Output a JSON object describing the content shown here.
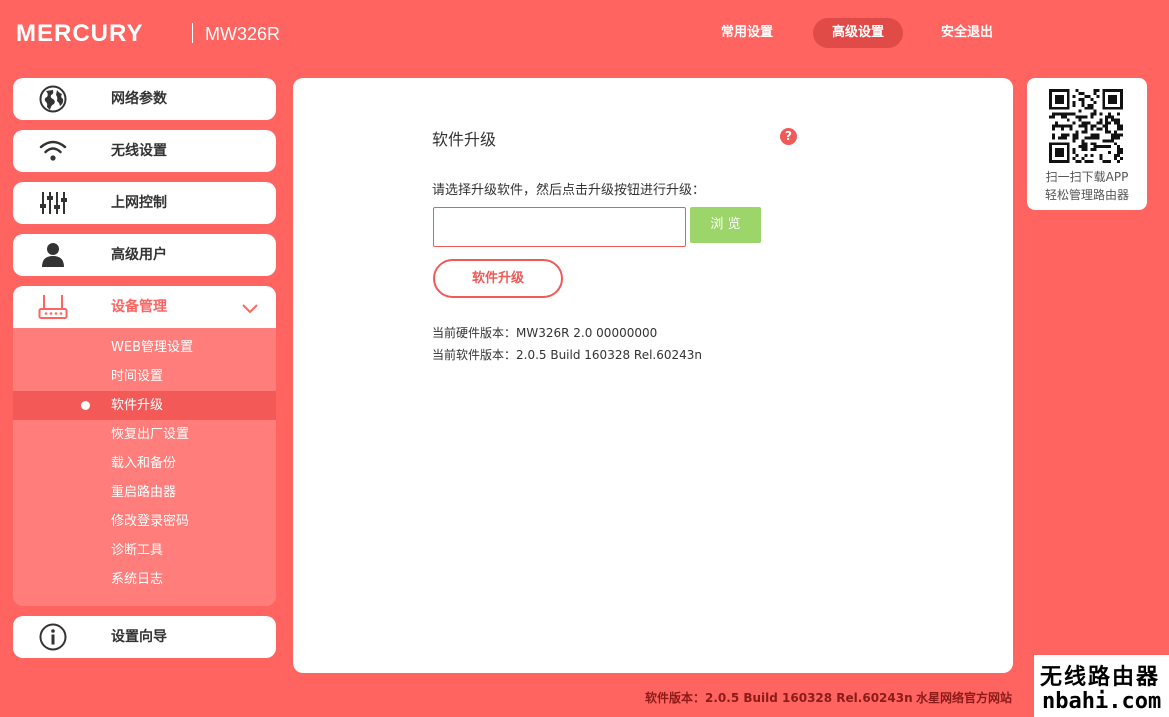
{
  "header": {
    "brand": "MERCURY",
    "model": "MW326R",
    "nav": {
      "common": "常用设置",
      "advanced": "高级设置",
      "logout": "安全退出"
    }
  },
  "sidebar": {
    "items": [
      {
        "label": "网络参数",
        "icon": "globe-icon"
      },
      {
        "label": "无线设置",
        "icon": "wifi-icon"
      },
      {
        "label": "上网控制",
        "icon": "sliders-icon"
      },
      {
        "label": "高级用户",
        "icon": "user-icon"
      },
      {
        "label": "设备管理",
        "icon": "router-icon"
      },
      {
        "label": "设置向导",
        "icon": "info-icon"
      }
    ],
    "submenu": [
      "WEB管理设置",
      "时间设置",
      "软件升级",
      "恢复出厂设置",
      "载入和备份",
      "重启路由器",
      "修改登录密码",
      "诊断工具",
      "系统日志"
    ]
  },
  "main": {
    "title": "软件升级",
    "help": "?",
    "instruction": "请选择升级软件，然后点击升级按钮进行升级：",
    "file_value": "",
    "browse_label": "浏 览",
    "upgrade_label": "软件升级",
    "hardware_version": "当前硬件版本：MW326R 2.0 00000000",
    "software_version": "当前软件版本：2.0.5 Build 160328 Rel.60243n"
  },
  "qr": {
    "line1": "扫一扫下载APP",
    "line2": "轻松管理路由器"
  },
  "footer": {
    "version": "软件版本：2.0.5 Build 160328 Rel.60243n",
    "link": "水星网络官方网站"
  },
  "watermark": {
    "line1": "无线路由器",
    "line2": "nbahi.com"
  },
  "colors": {
    "background": "#ff6461",
    "accent": "#f05a57",
    "browse": "#9cd56a",
    "footer_text": "#8b1b18"
  }
}
